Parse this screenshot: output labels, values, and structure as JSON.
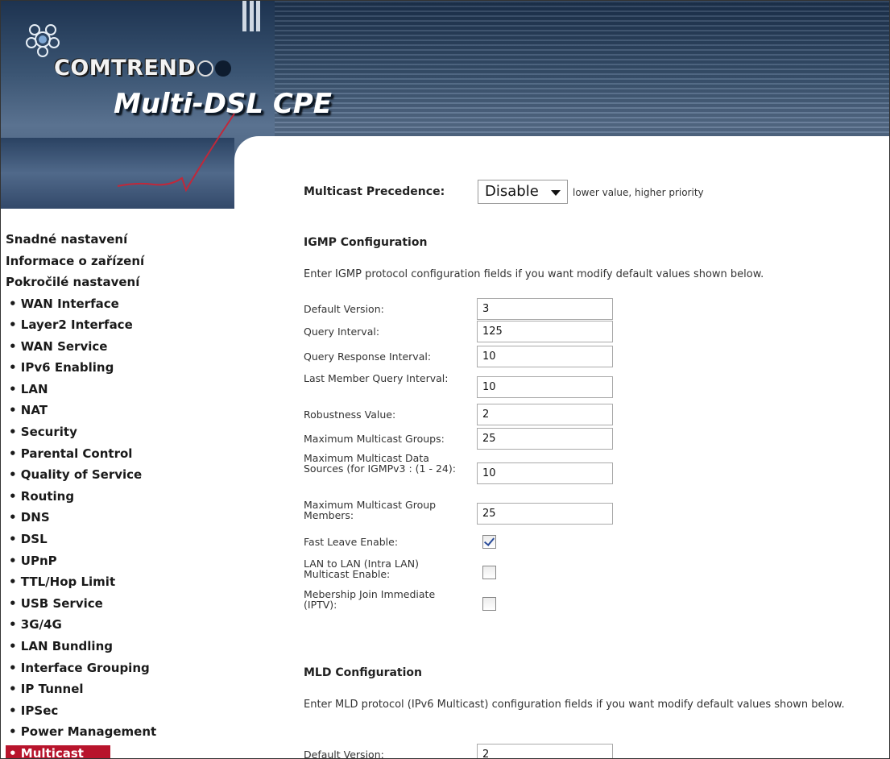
{
  "header": {
    "brand": "COMTREND",
    "product": "Multi-DSL CPE"
  },
  "sidebar": {
    "top_items": [
      "Snadné nastavení",
      "Informace o zařízení",
      "Pokročilé nastavení"
    ],
    "sub_items": [
      "• WAN Interface",
      "• Layer2 Interface",
      "• WAN Service",
      "• IPv6 Enabling",
      "• LAN",
      "• NAT",
      "• Security",
      "• Parental Control",
      "• Quality of Service",
      "• Routing",
      "• DNS",
      "• DSL",
      "• UPnP",
      "• TTL/Hop Limit",
      "• USB Service",
      "• 3G/4G",
      "• LAN Bundling",
      "• Interface Grouping",
      "• IP Tunnel",
      "• IPSec",
      "• Power Management"
    ],
    "active_item": "• Multicast"
  },
  "main": {
    "precedence": {
      "label": "Multicast Precedence:",
      "selected": "Disable",
      "hint": "lower value, higher priority"
    },
    "igmp": {
      "title": "IGMP Configuration",
      "description": "Enter IGMP protocol configuration fields if you want modify default values shown below.",
      "fields": {
        "default_version": {
          "label": "Default Version:",
          "value": "3"
        },
        "query_interval": {
          "label": "Query Interval:",
          "value": "125"
        },
        "query_response_interval": {
          "label": "Query Response Interval:",
          "value": "10"
        },
        "last_member_query_interval": {
          "label": "Last Member Query Interval:",
          "value": "10"
        },
        "robustness_value": {
          "label": "Robustness Value:",
          "value": "2"
        },
        "max_multicast_groups": {
          "label": "Maximum Multicast Groups:",
          "value": "25"
        },
        "max_multicast_data_sources": {
          "label": "Maximum Multicast Data Sources (for IGMPv3 : (1 - 24):",
          "value": "10"
        },
        "max_multicast_group_members": {
          "label": "Maximum Multicast Group Members:",
          "value": "25"
        }
      },
      "checkboxes": {
        "fast_leave": {
          "label": "Fast Leave Enable:",
          "checked": true
        },
        "lan_to_lan": {
          "label": "LAN to LAN (Intra LAN) Multicast Enable:",
          "checked": false
        },
        "membership_join": {
          "label": "Mebership Join Immediate (IPTV):",
          "checked": false
        }
      }
    },
    "mld": {
      "title": "MLD Configuration",
      "description": "Enter MLD protocol (IPv6 Multicast) configuration fields if you want modify default values shown below.",
      "default_version": {
        "label": "Default Version:",
        "value": "2"
      }
    }
  }
}
